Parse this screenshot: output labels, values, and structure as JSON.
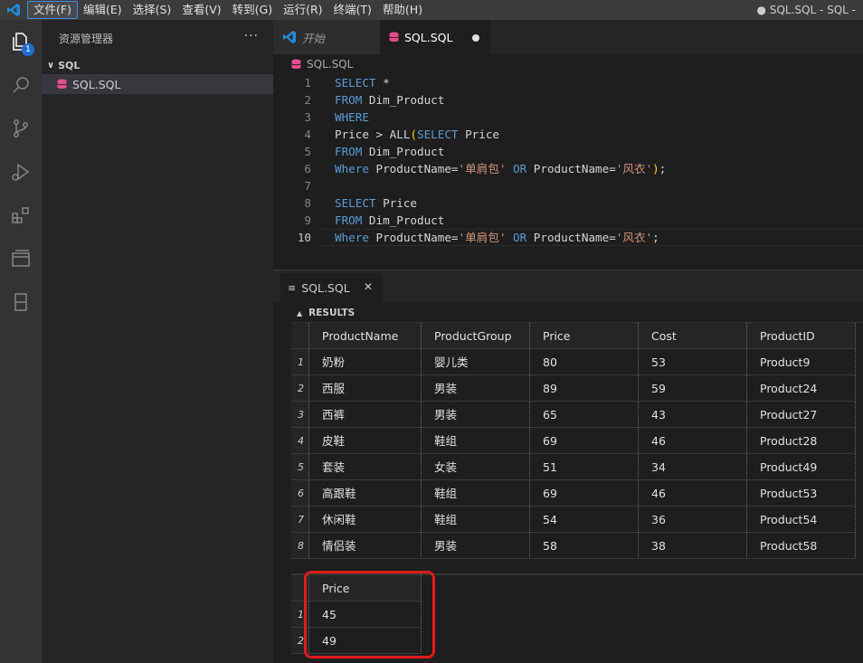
{
  "window_title": "● SQL.SQL - SQL -",
  "menu": [
    {
      "label": "文件(F)",
      "active": true
    },
    {
      "label": "编辑(E)"
    },
    {
      "label": "选择(S)"
    },
    {
      "label": "查看(V)"
    },
    {
      "label": "转到(G)"
    },
    {
      "label": "运行(R)"
    },
    {
      "label": "终端(T)"
    },
    {
      "label": "帮助(H)"
    }
  ],
  "activity": {
    "badge": "1"
  },
  "sidebar": {
    "title": "资源管理器",
    "more": "···",
    "section": "SQL",
    "file": "SQL.SQL"
  },
  "tabs": [
    {
      "label": "开始"
    },
    {
      "label": "SQL.SQL"
    }
  ],
  "breadcrumb": "SQL.SQL",
  "code": {
    "line_numbers": [
      "1",
      "2",
      "3",
      "4",
      "5",
      "6",
      "7",
      "8",
      "9",
      "10"
    ],
    "current_line": 10
  },
  "panel": {
    "tab_label": "SQL.SQL",
    "close": "✕",
    "results_header": "RESULTS"
  },
  "results1": {
    "columns": [
      "ProductName",
      "ProductGroup",
      "Price",
      "Cost",
      "ProductID"
    ],
    "rows": [
      [
        "1",
        "奶粉",
        "婴儿类",
        "80",
        "53",
        "Product9"
      ],
      [
        "2",
        "西服",
        "男装",
        "89",
        "59",
        "Product24"
      ],
      [
        "3",
        "西裤",
        "男装",
        "65",
        "43",
        "Product27"
      ],
      [
        "4",
        "皮鞋",
        "鞋组",
        "69",
        "46",
        "Product28"
      ],
      [
        "5",
        "套装",
        "女装",
        "51",
        "34",
        "Product49"
      ],
      [
        "6",
        "高跟鞋",
        "鞋组",
        "69",
        "46",
        "Product53"
      ],
      [
        "7",
        "休闲鞋",
        "鞋组",
        "54",
        "36",
        "Product54"
      ],
      [
        "8",
        "情侣装",
        "男装",
        "58",
        "38",
        "Product58"
      ]
    ]
  },
  "results2": {
    "columns": [
      "Price"
    ],
    "rows": [
      [
        "1",
        "45"
      ],
      [
        "2",
        "49"
      ]
    ]
  },
  "colors": {
    "keyword": "#569cd6",
    "string": "#ce9178",
    "highlight": "#e01c1c",
    "accent": "#3a8ee6"
  }
}
